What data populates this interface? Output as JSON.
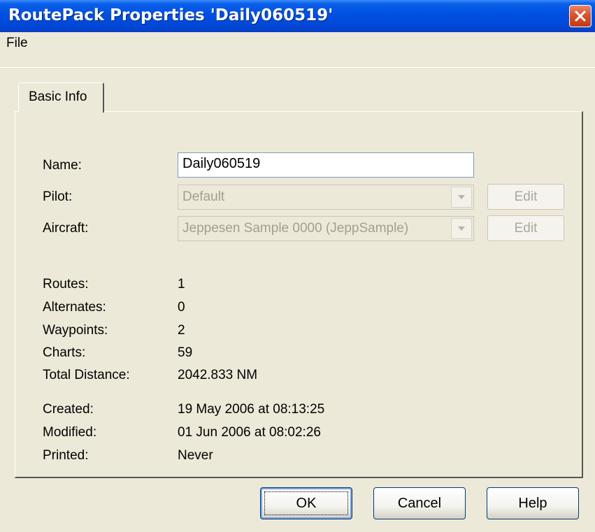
{
  "window": {
    "title": "RoutePack Properties 'Daily060519'",
    "close_icon": "close-icon"
  },
  "menu": {
    "file": "File"
  },
  "tabs": [
    {
      "label": "Basic Info"
    }
  ],
  "form": {
    "name_label": "Name:",
    "name_value": "Daily060519",
    "pilot_label": "Pilot:",
    "pilot_value": "Default",
    "pilot_edit": "Edit",
    "aircraft_label": "Aircraft:",
    "aircraft_value": "Jeppesen Sample 0000 (JeppSample)",
    "aircraft_edit": "Edit"
  },
  "stats": [
    {
      "label": "Routes:",
      "value": "1"
    },
    {
      "label": "Alternates:",
      "value": "0"
    },
    {
      "label": "Waypoints:",
      "value": "2"
    },
    {
      "label": "Charts:",
      "value": "59"
    },
    {
      "label": "Total Distance:",
      "value": "2042.833 NM"
    }
  ],
  "dates": [
    {
      "label": "Created:",
      "value": "19 May 2006 at 08:13:25"
    },
    {
      "label": "Modified:",
      "value": "01 Jun 2006 at 08:02:26"
    },
    {
      "label": "Printed:",
      "value": "Never"
    }
  ],
  "buttons": {
    "ok": "OK",
    "cancel": "Cancel",
    "help": "Help"
  },
  "colors": {
    "titlebar": "#0050e0",
    "close": "#d9532c",
    "dialog_bg": "#ece9d8",
    "disabled_text": "#a39f8f"
  }
}
